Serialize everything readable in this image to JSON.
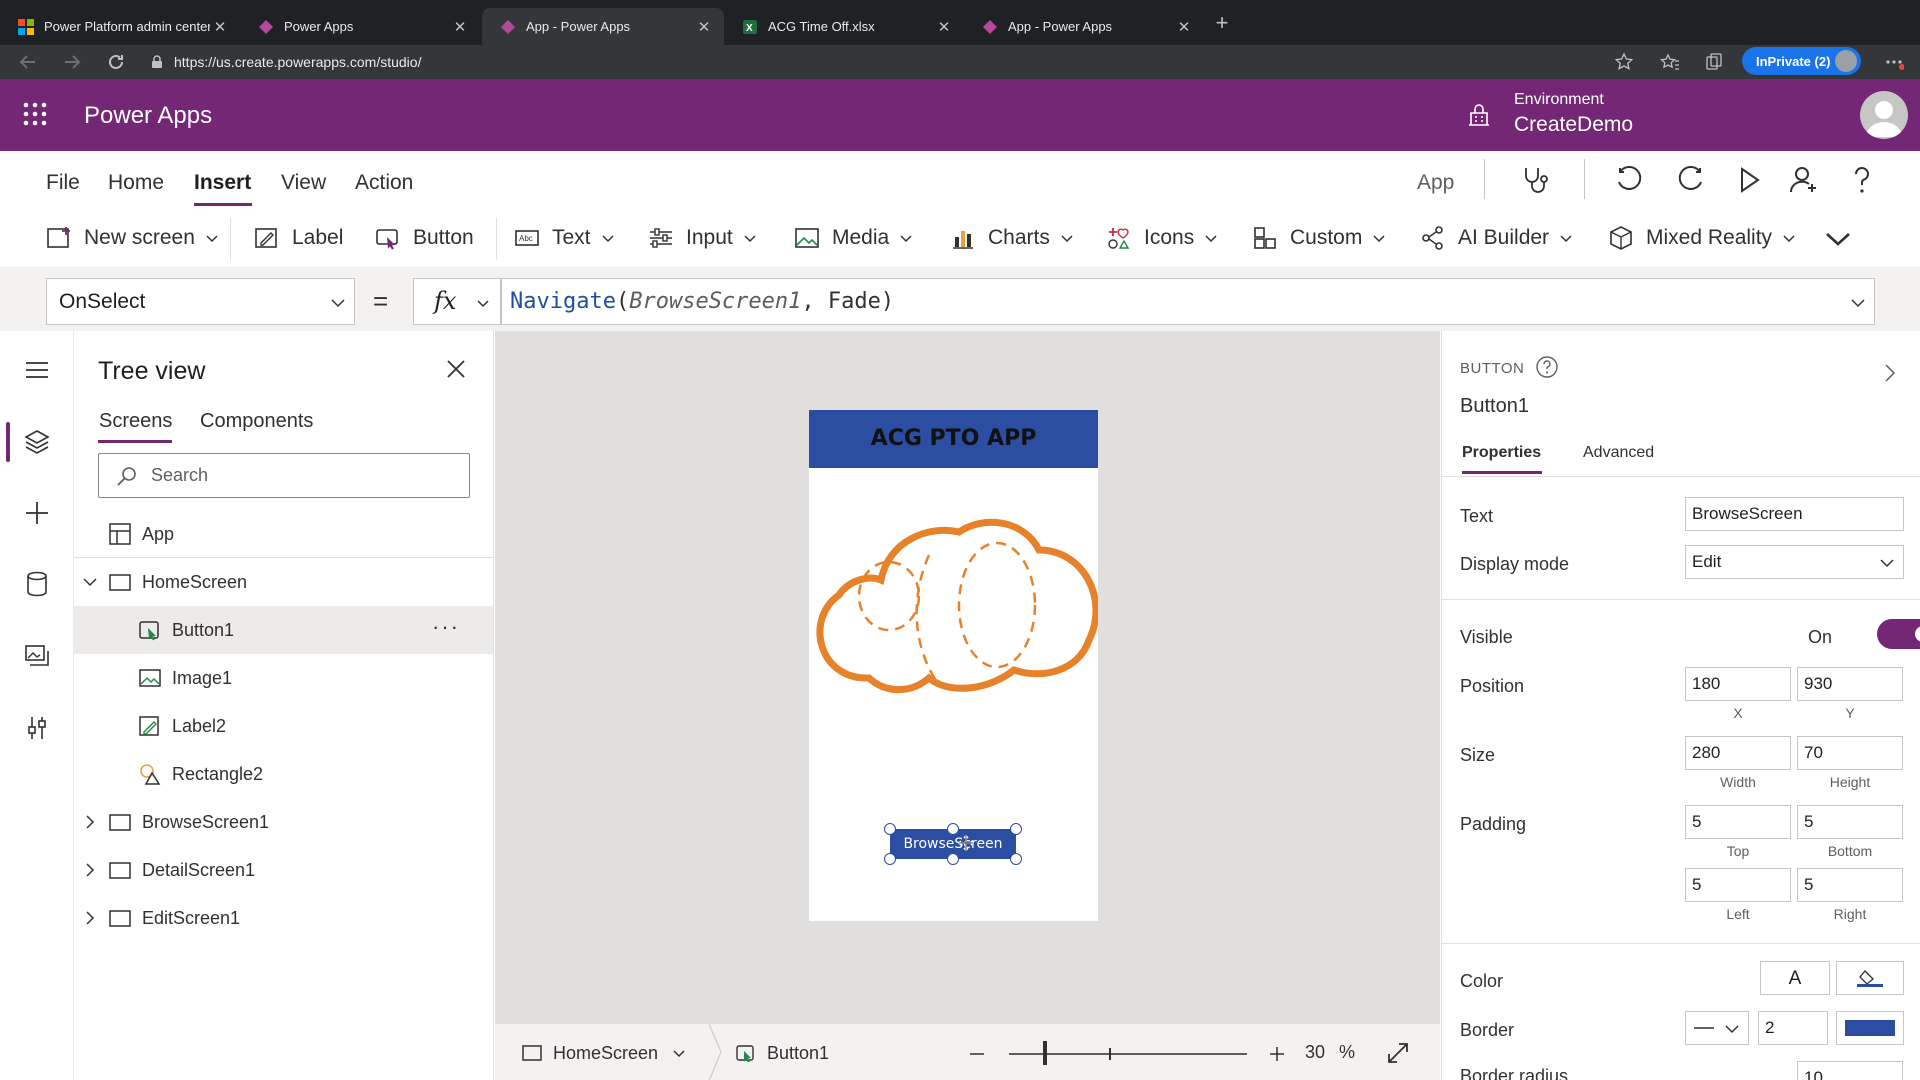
{
  "browser": {
    "tabs": [
      {
        "label": "Power Platform admin center"
      },
      {
        "label": "Power Apps"
      },
      {
        "label": "App - Power Apps"
      },
      {
        "label": "ACG Time Off.xlsx"
      },
      {
        "label": "App - Power Apps"
      }
    ],
    "url": "https://us.create.powerapps.com/studio/",
    "inprivate_label": "InPrivate (2)"
  },
  "header": {
    "app_title": "Power Apps",
    "environment_label": "Environment",
    "environment_name": "CreateDemo"
  },
  "menu": {
    "tabs": [
      "File",
      "Home",
      "Insert",
      "View",
      "Action"
    ],
    "active_tab": "Insert",
    "app_label": "App"
  },
  "commands": {
    "new_screen": "New screen",
    "label": "Label",
    "button": "Button",
    "text": "Text",
    "input": "Input",
    "media": "Media",
    "charts": "Charts",
    "icons": "Icons",
    "custom": "Custom",
    "ai_builder": "AI Builder",
    "mixed_reality": "Mixed Reality"
  },
  "formula_bar": {
    "property": "OnSelect",
    "equals": "=",
    "fx": "fx",
    "fn_name": "Navigate",
    "open_paren": "(",
    "arg1": "BrowseScreen1",
    "comma": ", ",
    "arg2": "Fade",
    "close_paren": ")"
  },
  "tree_view": {
    "title": "Tree view",
    "tabs": [
      "Screens",
      "Components"
    ],
    "search_placeholder": "Search",
    "nodes": [
      {
        "label": "App"
      },
      {
        "label": "HomeScreen"
      },
      {
        "label": "Button1"
      },
      {
        "label": "Image1"
      },
      {
        "label": "Label2"
      },
      {
        "label": "Rectangle2"
      },
      {
        "label": "BrowseScreen1"
      },
      {
        "label": "DetailScreen1"
      },
      {
        "label": "EditScreen1"
      }
    ],
    "more": "···"
  },
  "canvas": {
    "header_text": "ACG PTO APP",
    "button_text": "BrowseScreen",
    "header_color": "#2b4ea2",
    "cloud_color": "#e8822a"
  },
  "statusbar": {
    "screen": "HomeScreen",
    "control": "Button1",
    "zoom_value": "30",
    "zoom_unit": "%",
    "zoom_fraction": 0.15
  },
  "properties": {
    "type": "BUTTON",
    "name": "Button1",
    "tabs": [
      "Properties",
      "Advanced"
    ],
    "text_label": "Text",
    "text_value": "BrowseScreen",
    "display_mode_label": "Display mode",
    "display_mode_value": "Edit",
    "visible_label": "Visible",
    "visible_value": "On",
    "position_label": "Position",
    "x_value": "180",
    "x_label": "X",
    "y_value": "930",
    "y_label": "Y",
    "size_label": "Size",
    "width_value": "280",
    "width_label": "Width",
    "height_value": "70",
    "height_label": "Height",
    "padding_label": "Padding",
    "top_value": "5",
    "top_label": "Top",
    "bottom_value": "5",
    "bottom_label": "Bottom",
    "left_value": "5",
    "left_label": "Left",
    "right_value": "5",
    "right_label": "Right",
    "color_label": "Color",
    "color_text_glyph": "A",
    "border_label": "Border",
    "border_width": "2",
    "border_color": "#2b4ea2",
    "border_radius_label": "Border radius",
    "border_radius_value": "10"
  },
  "colors": {
    "brand": "#742774",
    "button_fill": "#2b4ea2"
  }
}
